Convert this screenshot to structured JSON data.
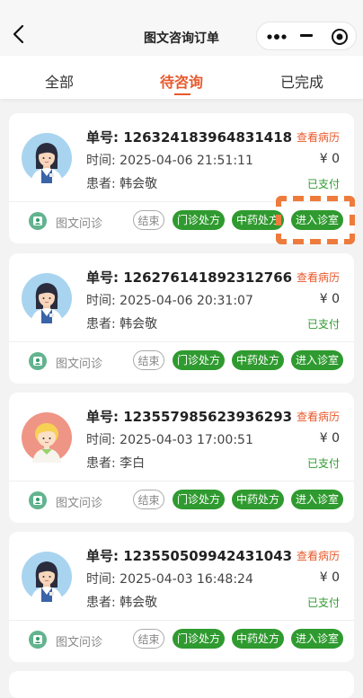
{
  "nav": {
    "title": "图文咨询订单"
  },
  "tabs": [
    {
      "label": "全部"
    },
    {
      "label": "待咨询"
    },
    {
      "label": "已完成"
    }
  ],
  "orders": [
    {
      "order_label": "单号:",
      "order_no": "126324183964831418",
      "time_label": "时间:",
      "time": "2025-04-06 21:51:11",
      "patient_label": "患者:",
      "patient": "韩会敬",
      "history": "查看病历",
      "amount": "¥ 0",
      "status": "已支付",
      "consult_type": "图文问诊",
      "buttons": {
        "end": "结束",
        "outpatient": "门诊处方",
        "herbal": "中药处方",
        "enter": "进入诊室"
      },
      "avatar": "female-doctor-avatar"
    },
    {
      "order_label": "单号:",
      "order_no": "126276141892312766",
      "time_label": "时间:",
      "time": "2025-04-06 20:31:07",
      "patient_label": "患者:",
      "patient": "韩会敬",
      "history": "查看病历",
      "amount": "¥ 0",
      "status": "已支付",
      "consult_type": "图文问诊",
      "buttons": {
        "end": "结束",
        "outpatient": "门诊处方",
        "herbal": "中药处方",
        "enter": "进入诊室"
      },
      "avatar": "female-doctor-avatar"
    },
    {
      "order_label": "单号:",
      "order_no": "123557985623936293",
      "time_label": "时间:",
      "time": "2025-04-03 17:00:51",
      "patient_label": "患者:",
      "patient": "李白",
      "history": "查看病历",
      "amount": "¥ 0",
      "status": "已支付",
      "consult_type": "图文问诊",
      "buttons": {
        "end": "结束",
        "outpatient": "门诊处方",
        "herbal": "中药处方",
        "enter": "进入诊室"
      },
      "avatar": "child-avatar"
    },
    {
      "order_label": "单号:",
      "order_no": "123550509942431043",
      "time_label": "时间:",
      "time": "2025-04-03 16:48:24",
      "patient_label": "患者:",
      "patient": "韩会敬",
      "history": "查看病历",
      "amount": "¥ 0",
      "status": "已支付",
      "consult_type": "图文问诊",
      "buttons": {
        "end": "结束",
        "outpatient": "门诊处方",
        "herbal": "中药处方",
        "enter": "进入诊室"
      },
      "avatar": "female-doctor-avatar"
    }
  ],
  "colors": {
    "accent": "#e8592b",
    "green": "#2f9a2f",
    "highlight": "#ee7b3c"
  }
}
